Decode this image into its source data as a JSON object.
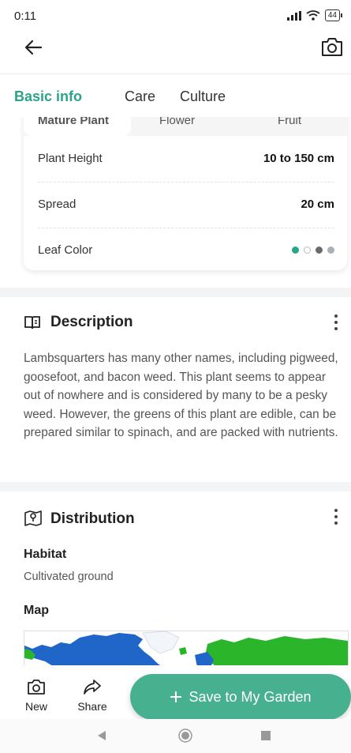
{
  "status_bar": {
    "time": "0:11",
    "battery": "44"
  },
  "tabs": [
    {
      "label": "Basic info",
      "active": true
    },
    {
      "label": "Care",
      "active": false
    },
    {
      "label": "Culture",
      "active": false
    }
  ],
  "stages": [
    "Mature Plant",
    "Flower",
    "Fruit"
  ],
  "attributes": [
    {
      "label": "Plant Height",
      "value": "10 to 150 cm"
    },
    {
      "label": "Spread",
      "value": "20 cm"
    },
    {
      "label": "Leaf Color",
      "value": ""
    }
  ],
  "leaf_colors": [
    "#22a884",
    "#ffffff",
    "#6b6b6b",
    "#a9b1b8"
  ],
  "description": {
    "title": "Description",
    "text": "Lambsquarters has many other names, including pigweed, goosefoot, and bacon weed. This plant seems to appear out of nowhere and is considered by many to be a pesky weed. However, the greens of this plant are edible, can be prepared similar to spinach, and are packed with nutrients."
  },
  "distribution": {
    "title": "Distribution",
    "habitat_heading": "Habitat",
    "habitat_value": "Cultivated ground",
    "map_heading": "Map"
  },
  "bottom_bar": {
    "new_label": "New",
    "share_label": "Share",
    "save_label": "Save to My Garden"
  },
  "colors": {
    "accent": "#2aa38a",
    "button": "#47b08e",
    "map_native": "#1f66c8",
    "map_introduced": "#2bb52b"
  }
}
